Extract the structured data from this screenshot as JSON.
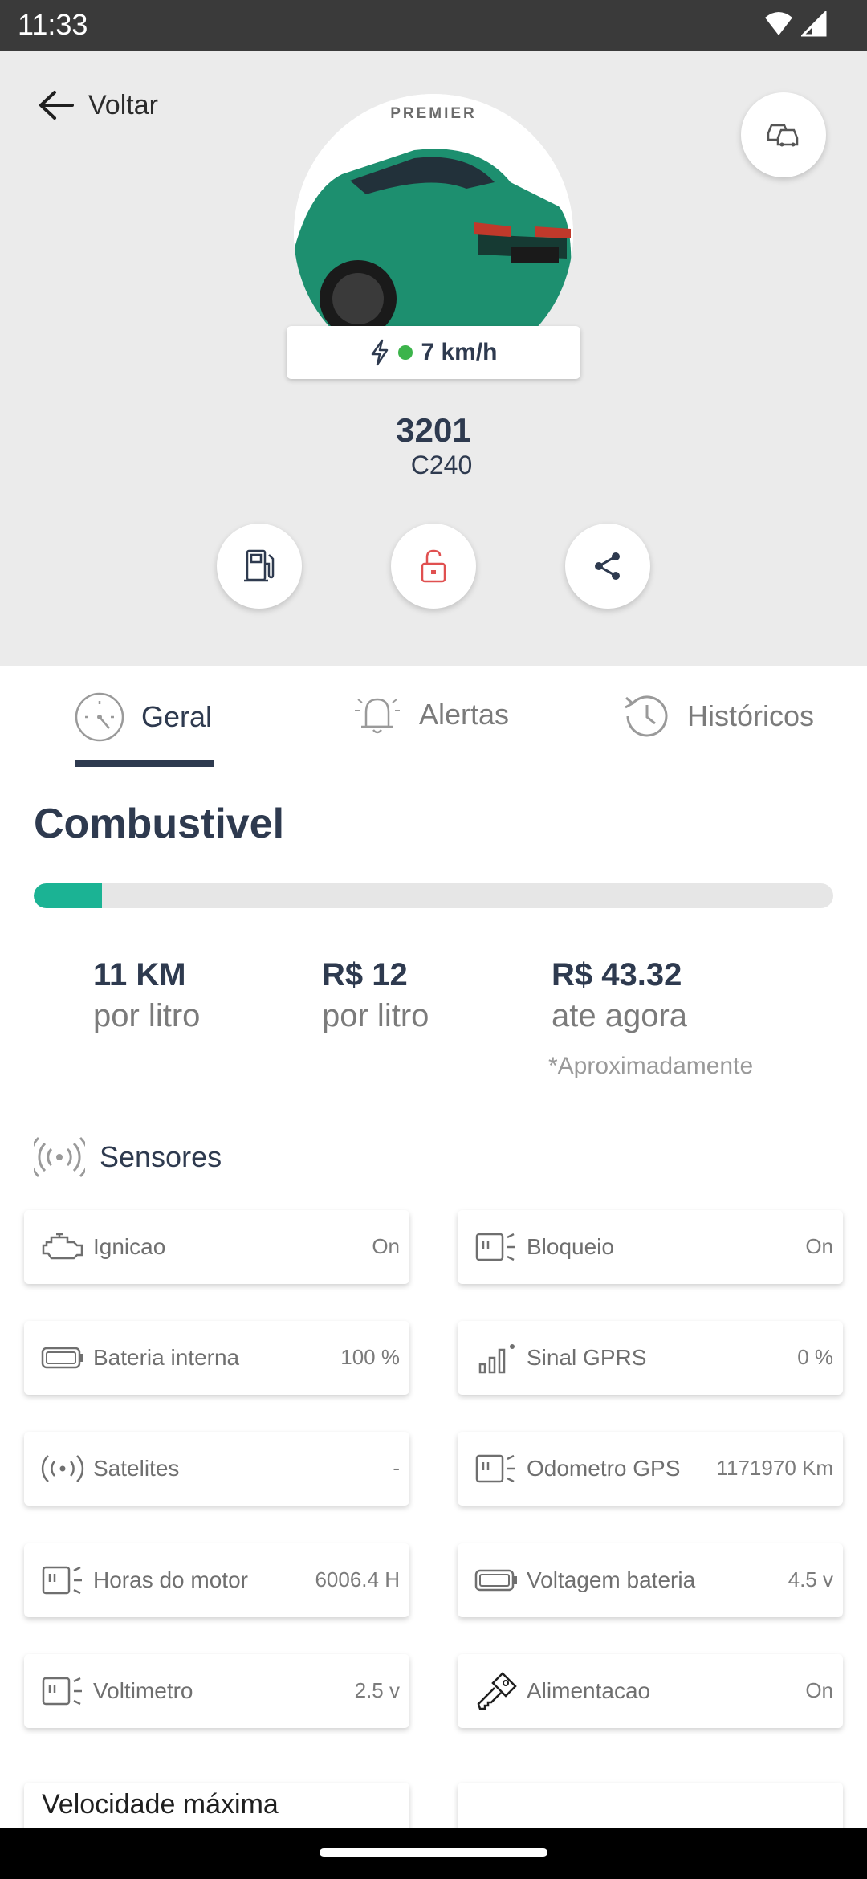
{
  "status": {
    "time": "11:33"
  },
  "header": {
    "back_label": "Voltar",
    "speed": "7 km/h",
    "vehicle_id": "3201",
    "vehicle_model": "C240",
    "car_plate_brand": "PREMIER"
  },
  "tabs": [
    {
      "label": "Geral",
      "active": true
    },
    {
      "label": "Alertas",
      "active": false
    },
    {
      "label": "Históricos",
      "active": false
    }
  ],
  "fuel": {
    "title": "Combustivel",
    "level": 0.085,
    "stats": [
      {
        "value": "11 KM",
        "label": "por litro"
      },
      {
        "value": "R$ 12",
        "label": "por litro"
      },
      {
        "value": "R$ 43.32",
        "label": "ate agora"
      }
    ],
    "note": "*Aproximadamente"
  },
  "sensors": {
    "title": "Sensores",
    "items": [
      {
        "label": "Ignicao",
        "value": "On",
        "icon": "engine-icon"
      },
      {
        "label": "Bloqueio",
        "value": "On",
        "icon": "headlight-icon"
      },
      {
        "label": "Bateria interna",
        "value": "100 %",
        "icon": "battery-icon"
      },
      {
        "label": "Sinal GPRS",
        "value": "0 %",
        "icon": "signal-bars-icon"
      },
      {
        "label": "Satelites",
        "value": "-",
        "icon": "satellite-icon"
      },
      {
        "label": "Odometro GPS",
        "value": "1171970 Km",
        "icon": "headlight-icon"
      },
      {
        "label": "Horas do motor",
        "value": "6006.4 H",
        "icon": "headlight-icon"
      },
      {
        "label": "Voltagem bateria",
        "value": "4.5 v",
        "icon": "battery-icon"
      },
      {
        "label": "Voltimetro",
        "value": "2.5 v",
        "icon": "headlight-icon"
      },
      {
        "label": "Alimentacao",
        "value": "On",
        "icon": "key-icon"
      }
    ]
  },
  "max_speed": {
    "title": "Velocidade máxima"
  },
  "colors": {
    "accent": "#1bb394",
    "dark": "#2e3a4f",
    "online": "#3cb44b",
    "lock": "#e05050"
  }
}
